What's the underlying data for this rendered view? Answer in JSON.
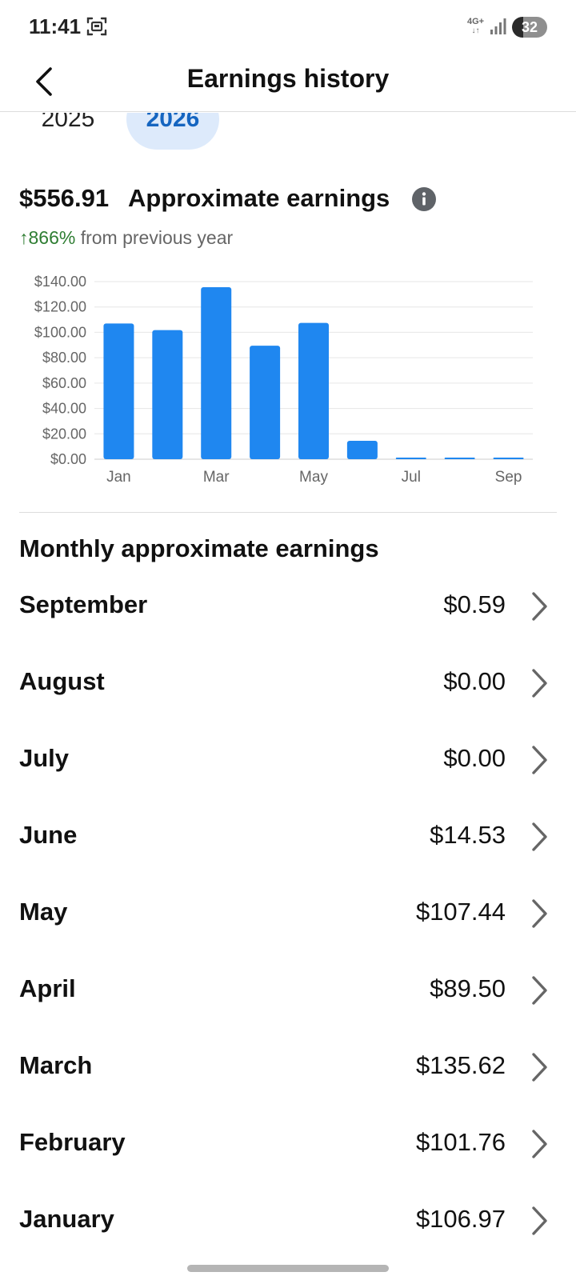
{
  "status_bar": {
    "time": "11:41",
    "network": "4G+",
    "battery": "32"
  },
  "app_bar": {
    "title": "Earnings history"
  },
  "year_tabs": [
    {
      "label": "2025",
      "selected": false
    },
    {
      "label": "2026",
      "selected": true
    }
  ],
  "summary": {
    "amount": "$556.91",
    "title": "Approximate earnings",
    "change_arrow": "↑",
    "change_value": "866%",
    "change_text": "from previous year"
  },
  "chart_data": {
    "type": "bar",
    "categories": [
      "Jan",
      "Feb",
      "Mar",
      "Apr",
      "May",
      "Jun",
      "Jul",
      "Aug",
      "Sep"
    ],
    "values": [
      106.97,
      101.76,
      135.62,
      89.5,
      107.44,
      14.53,
      0.0,
      0.0,
      0.59
    ],
    "x_tick_labels": [
      "Jan",
      "Mar",
      "May",
      "Jul",
      "Sep"
    ],
    "y_ticks": [
      "$0.00",
      "$20.00",
      "$40.00",
      "$60.00",
      "$80.00",
      "$100.00",
      "$120.00",
      "$140.00"
    ],
    "ylim": [
      0,
      140
    ],
    "grid": true,
    "bar_color": "#1f87f0"
  },
  "monthly": {
    "heading": "Monthly approximate earnings",
    "rows": [
      {
        "month": "September",
        "value": "$0.59"
      },
      {
        "month": "August",
        "value": "$0.00"
      },
      {
        "month": "July",
        "value": "$0.00"
      },
      {
        "month": "June",
        "value": "$14.53"
      },
      {
        "month": "May",
        "value": "$107.44"
      },
      {
        "month": "April",
        "value": "$89.50"
      },
      {
        "month": "March",
        "value": "$135.62"
      },
      {
        "month": "February",
        "value": "$101.76"
      },
      {
        "month": "January",
        "value": "$106.97"
      }
    ]
  },
  "colors": {
    "accent": "#1565c0",
    "selected_tab_bg": "#ddeafb",
    "positive": "#2e7d32"
  }
}
